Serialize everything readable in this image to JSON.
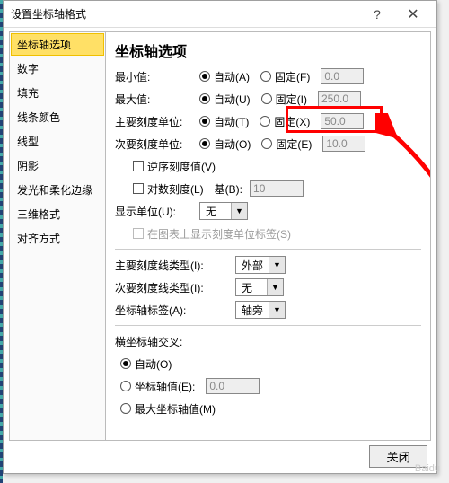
{
  "titlebar": {
    "title": "设置坐标轴格式"
  },
  "sidebar": {
    "items": [
      {
        "label": "坐标轴选项"
      },
      {
        "label": "数字"
      },
      {
        "label": "填充"
      },
      {
        "label": "线条颜色"
      },
      {
        "label": "线型"
      },
      {
        "label": "阴影"
      },
      {
        "label": "发光和柔化边缘"
      },
      {
        "label": "三维格式"
      },
      {
        "label": "对齐方式"
      }
    ]
  },
  "main": {
    "heading": "坐标轴选项",
    "rows": {
      "min": {
        "label": "最小值:",
        "auto": "自动(A)",
        "fixed": "固定(F)",
        "value": "0.0"
      },
      "max": {
        "label": "最大值:",
        "auto": "自动(U)",
        "fixed": "固定(I)",
        "value": "250.0"
      },
      "major": {
        "label": "主要刻度单位:",
        "auto": "自动(T)",
        "fixed": "固定(X)",
        "value": "50.0"
      },
      "minor": {
        "label": "次要刻度单位:",
        "auto": "自动(O)",
        "fixed": "固定(E)",
        "value": "10.0"
      },
      "reverse": "逆序刻度值(V)",
      "logscale": {
        "label": "对数刻度(L)",
        "base_label": "基(B):",
        "base_value": "10"
      },
      "display_unit": {
        "label": "显示单位(U):",
        "value": "无"
      },
      "show_unit_label": "在图表上显示刻度单位标签(S)",
      "major_tick": {
        "label": "主要刻度线类型(I):",
        "value": "外部"
      },
      "minor_tick": {
        "label": "次要刻度线类型(I):",
        "value": "无"
      },
      "axis_labels": {
        "label": "坐标轴标签(A):",
        "value": "轴旁"
      },
      "cross_heading": "横坐标轴交叉:",
      "cross_auto": "自动(O)",
      "cross_value": {
        "label": "坐标轴值(E):",
        "value": "0.0"
      },
      "cross_max": "最大坐标轴值(M)"
    }
  },
  "footer": {
    "close_label": "关闭"
  },
  "watermark": "Baidu"
}
